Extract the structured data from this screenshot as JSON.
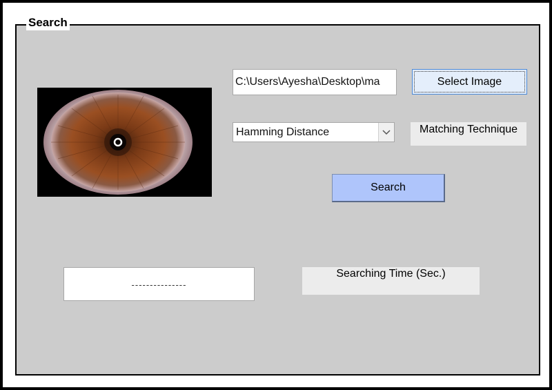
{
  "group": {
    "title": "Search"
  },
  "image_path": {
    "value": "C:\\Users\\Ayesha\\Desktop\\ma"
  },
  "buttons": {
    "select_image": "Select Image",
    "search": "Search"
  },
  "technique": {
    "selected": "Hamming Distance",
    "label": "Matching Technique"
  },
  "result": {
    "value": "---------------"
  },
  "time": {
    "label": "Searching Time (Sec.)"
  },
  "icons": {
    "dropdown": "chevron-down-icon"
  }
}
